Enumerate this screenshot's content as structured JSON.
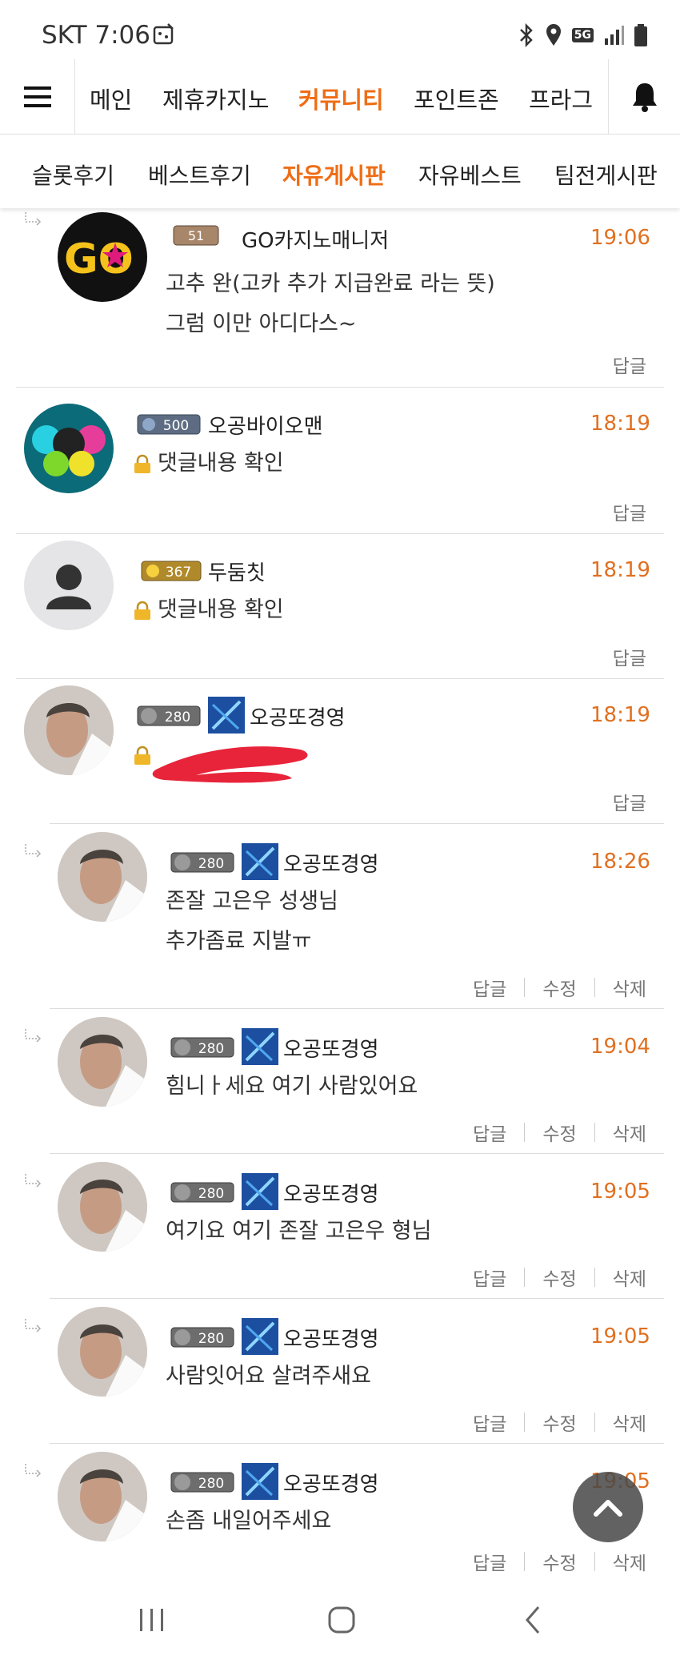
{
  "status_bar": {
    "carrier_time": "SKT 7:06",
    "network": "5G",
    "icons": [
      "bluetooth-icon",
      "location-icon",
      "5g-icon",
      "signal-icon",
      "battery-icon"
    ]
  },
  "nav": {
    "items": [
      "메인",
      "제휴카지노",
      "커뮤니티",
      "포인트존",
      "프라그"
    ],
    "active": "커뮤니티"
  },
  "subnav": {
    "items": [
      "슬롯후기",
      "베스트후기",
      "자유게시판",
      "자유베스트",
      "팀전게시판"
    ],
    "active": "자유게시판"
  },
  "colors": {
    "accent": "#ef6d15",
    "time": "#e07020"
  },
  "comments": [
    {
      "author": "GO카지노매니저",
      "level": "51",
      "time": "19:06",
      "lines": [
        "고추 완(고카 추가 지급완료 라는 뜻)",
        "그럼 이만 아디다스~"
      ],
      "actions": [
        "답글"
      ]
    },
    {
      "author": "오공바이오맨",
      "level": "500",
      "time": "18:19",
      "lines": [
        "댓글내용 확인"
      ],
      "locked": true,
      "actions": [
        "답글"
      ]
    },
    {
      "author": "두둠칫",
      "level": "367",
      "time": "18:19",
      "lines": [
        "댓글내용 확인"
      ],
      "locked": true,
      "actions": [
        "답글"
      ]
    },
    {
      "author": "오공또경영",
      "level": "280",
      "time": "18:19",
      "lines": [
        ""
      ],
      "locked": true,
      "actions": [
        "답글"
      ]
    },
    {
      "author": "오공또경영",
      "level": "280",
      "time": "18:26",
      "lines": [
        "존잘 고은우 성생님",
        "추가좀료 지발ㅠ"
      ],
      "actions": [
        "답글",
        "수정",
        "삭제"
      ]
    },
    {
      "author": "오공또경영",
      "level": "280",
      "time": "19:04",
      "lines": [
        "힘니ㅏ세요 여기 사람있어요"
      ],
      "actions": [
        "답글",
        "수정",
        "삭제"
      ]
    },
    {
      "author": "오공또경영",
      "level": "280",
      "time": "19:05",
      "lines": [
        "여기요 여기 존잘 고은우 형님"
      ],
      "actions": [
        "답글",
        "수정",
        "삭제"
      ]
    },
    {
      "author": "오공또경영",
      "level": "280",
      "time": "19:05",
      "lines": [
        "사람잇어요 살려주새요"
      ],
      "actions": [
        "답글",
        "수정",
        "삭제"
      ]
    },
    {
      "author": "오공또경영",
      "level": "280",
      "time": "19:05",
      "lines": [
        "손좀 내일어주세요"
      ],
      "actions": [
        "답글",
        "수정",
        "삭제"
      ]
    }
  ]
}
